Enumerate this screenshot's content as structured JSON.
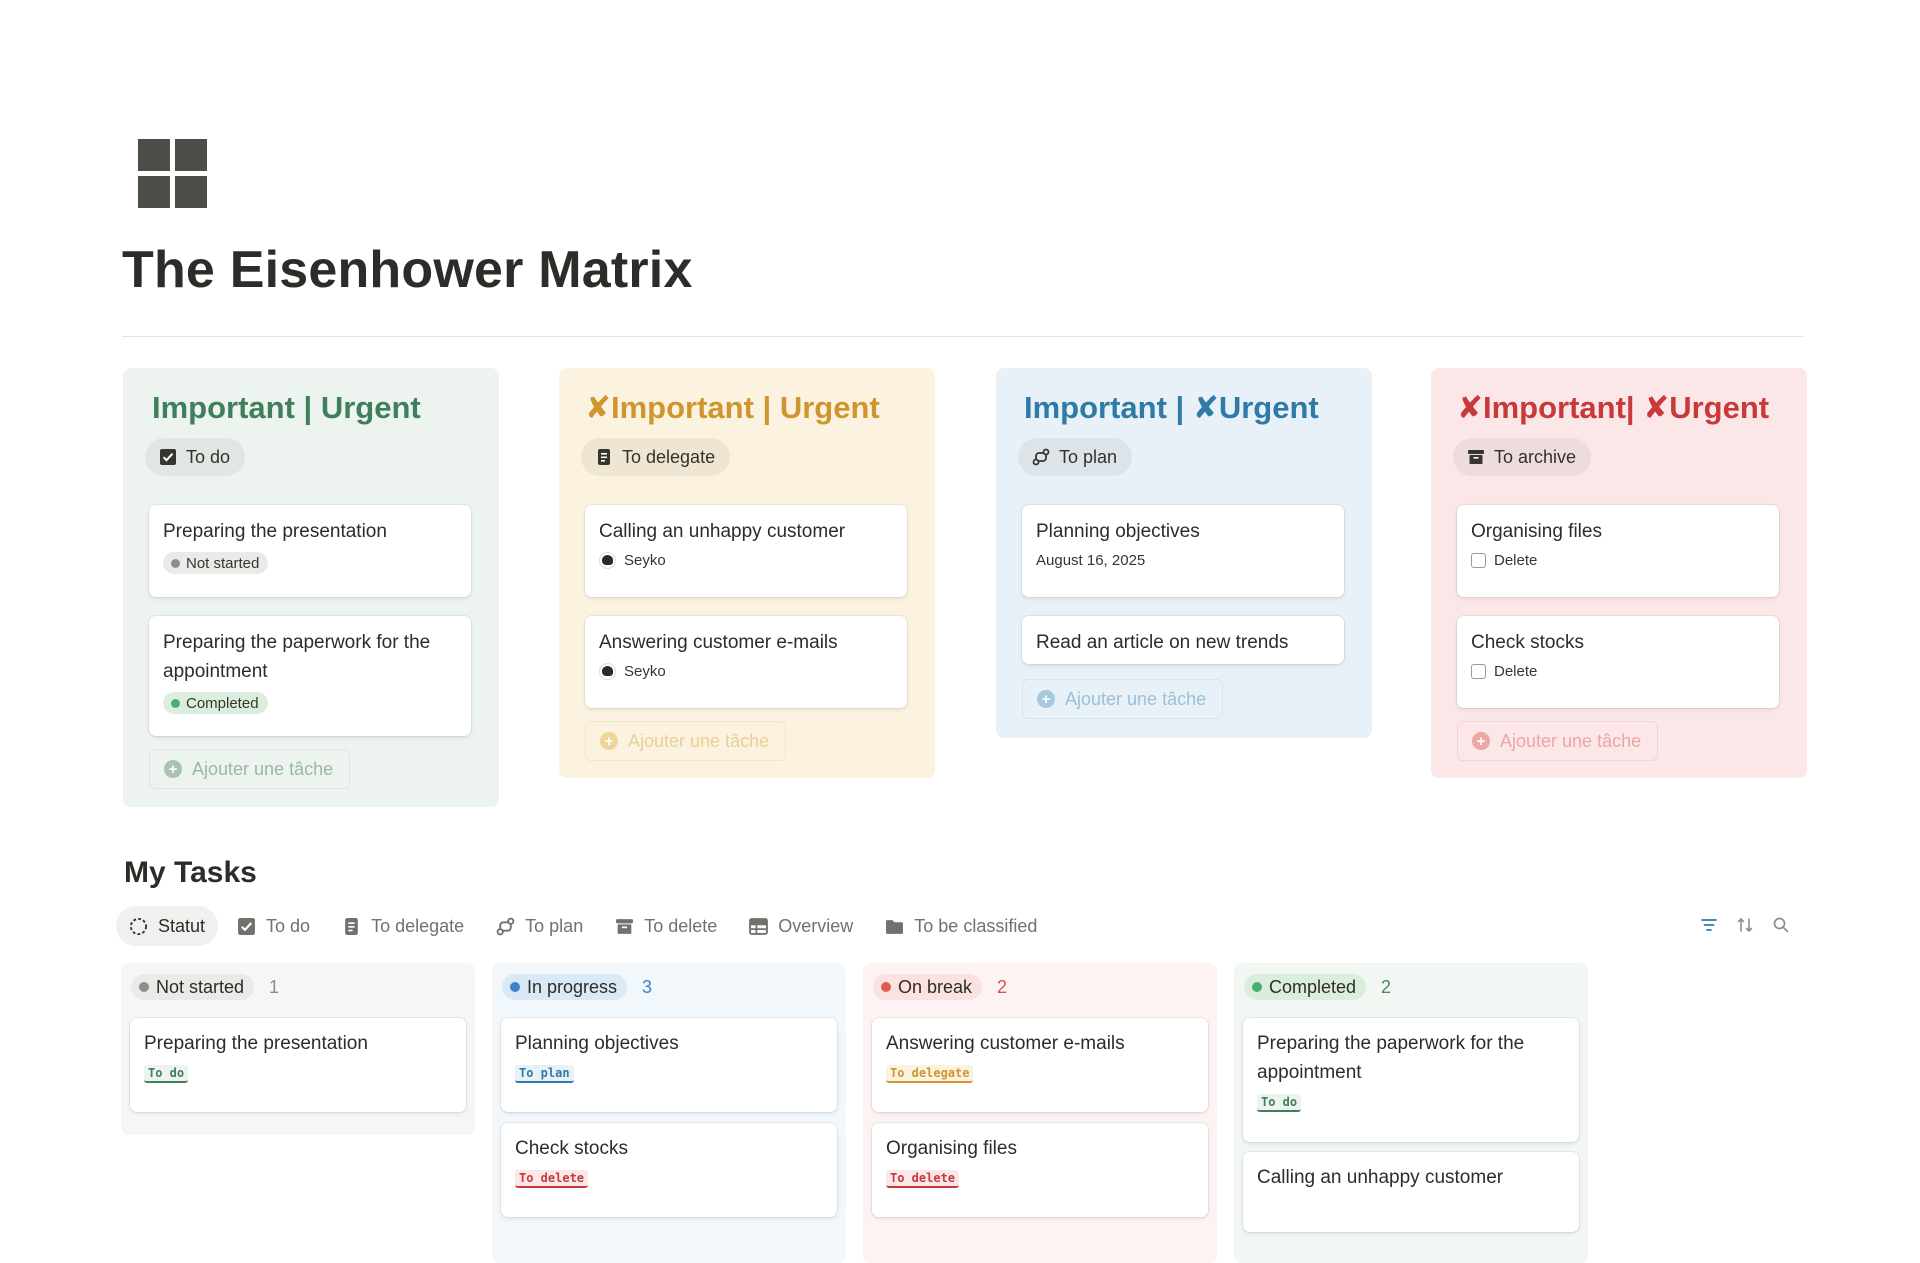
{
  "page": {
    "title": "The Eisenhower Matrix",
    "icon": "grid-icon"
  },
  "quadrants": [
    {
      "id": "do",
      "heading": "Important | Urgent",
      "heading_color": "#3f7f5e",
      "bg": "#edf3ee",
      "tag": {
        "icon": "checkbox-icon",
        "label": "To do"
      },
      "cards": [
        {
          "title": "Preparing the presentation",
          "status": "Not started"
        },
        {
          "title": "Preparing the paperwork for the appointment",
          "status": "Completed"
        }
      ],
      "add_label": "Ajouter une tâche"
    },
    {
      "id": "delegate",
      "x_mark": "✘",
      "heading": "Important | Urgent",
      "heading_color": "#cf9630",
      "bg": "#fbf3df",
      "tag": {
        "icon": "clipboard-icon",
        "label": "To delegate"
      },
      "cards": [
        {
          "title": "Calling an unhappy customer",
          "person": "Seyko"
        },
        {
          "title": "Answering customer e-mails",
          "person": "Seyko"
        }
      ],
      "add_label": "Ajouter une tâche"
    },
    {
      "id": "plan",
      "heading_prefix": "Important | ",
      "x_mark": "✘",
      "heading_suffix": "Urgent",
      "heading_color": "#2f7ba5",
      "bg": "#e8f1f7",
      "tag": {
        "icon": "route-icon",
        "label": "To plan"
      },
      "cards": [
        {
          "title": "Planning objectives",
          "date": "August 16, 2025"
        },
        {
          "title": "Read an article on new trends"
        }
      ],
      "add_label": "Ajouter une tâche"
    },
    {
      "id": "archive",
      "x_mark": "✘",
      "heading_prefix": "Important| ",
      "heading_suffix": "Urgent",
      "heading_color": "#c8393a",
      "bg": "#fbe7e7",
      "tag": {
        "icon": "archive-icon",
        "label": "To archive"
      },
      "cards": [
        {
          "title": "Organising files",
          "checkbox_label": "Delete"
        },
        {
          "title": "Check stocks",
          "checkbox_label": "Delete"
        }
      ],
      "add_label": "Ajouter une tâche"
    }
  ],
  "my_tasks": {
    "title": "My Tasks",
    "tabs": [
      "Statut",
      "To do",
      "To delegate",
      "To plan",
      "To delete",
      "Overview",
      "To be classified"
    ],
    "columns": [
      {
        "label": "Not started",
        "count": "1",
        "dot": "#8f8d89",
        "pill_bg": "#ebeae8",
        "count_color": "#8f8d89",
        "bg": "#f7f6f4",
        "cards": [
          {
            "title": "Preparing the presentation",
            "tag": "To do",
            "tag_color": "#3f7f5e",
            "tag_bg": "#edf3ee"
          }
        ]
      },
      {
        "label": "In progress",
        "count": "3",
        "dot": "#3b82c8",
        "pill_bg": "#dbe9f7",
        "count_color": "#3b82c8",
        "bg": "#f2f7fb",
        "cards": [
          {
            "title": "Planning objectives",
            "tag": "To plan",
            "tag_color": "#2f7ba5",
            "tag_bg": "#e8f1f7"
          },
          {
            "title": "Check stocks",
            "tag": "To delete",
            "tag_color": "#c8393a",
            "tag_bg": "#fbe7e7"
          }
        ]
      },
      {
        "label": "On break",
        "count": "2",
        "dot": "#e05c56",
        "pill_bg": "#fbe1df",
        "count_color": "#d9534f",
        "bg": "#fcf3f2",
        "cards": [
          {
            "title": "Answering customer e-mails",
            "tag": "To delegate",
            "tag_color": "#cf9630",
            "tag_bg": "#fbf3df"
          },
          {
            "title": "Organising files",
            "tag": "To delete",
            "tag_color": "#c8393a",
            "tag_bg": "#fbe7e7"
          }
        ]
      },
      {
        "label": "Completed",
        "count": "2",
        "dot": "#4caf72",
        "pill_bg": "#dbeedd",
        "count_color": "#4b8a61",
        "bg": "#f2f7f3",
        "cards": [
          {
            "title": "Preparing the paperwork for the appointment",
            "tag": "To do",
            "tag_color": "#3f7f5e",
            "tag_bg": "#edf3ee"
          },
          {
            "title": "Calling an unhappy customer"
          }
        ]
      }
    ]
  }
}
